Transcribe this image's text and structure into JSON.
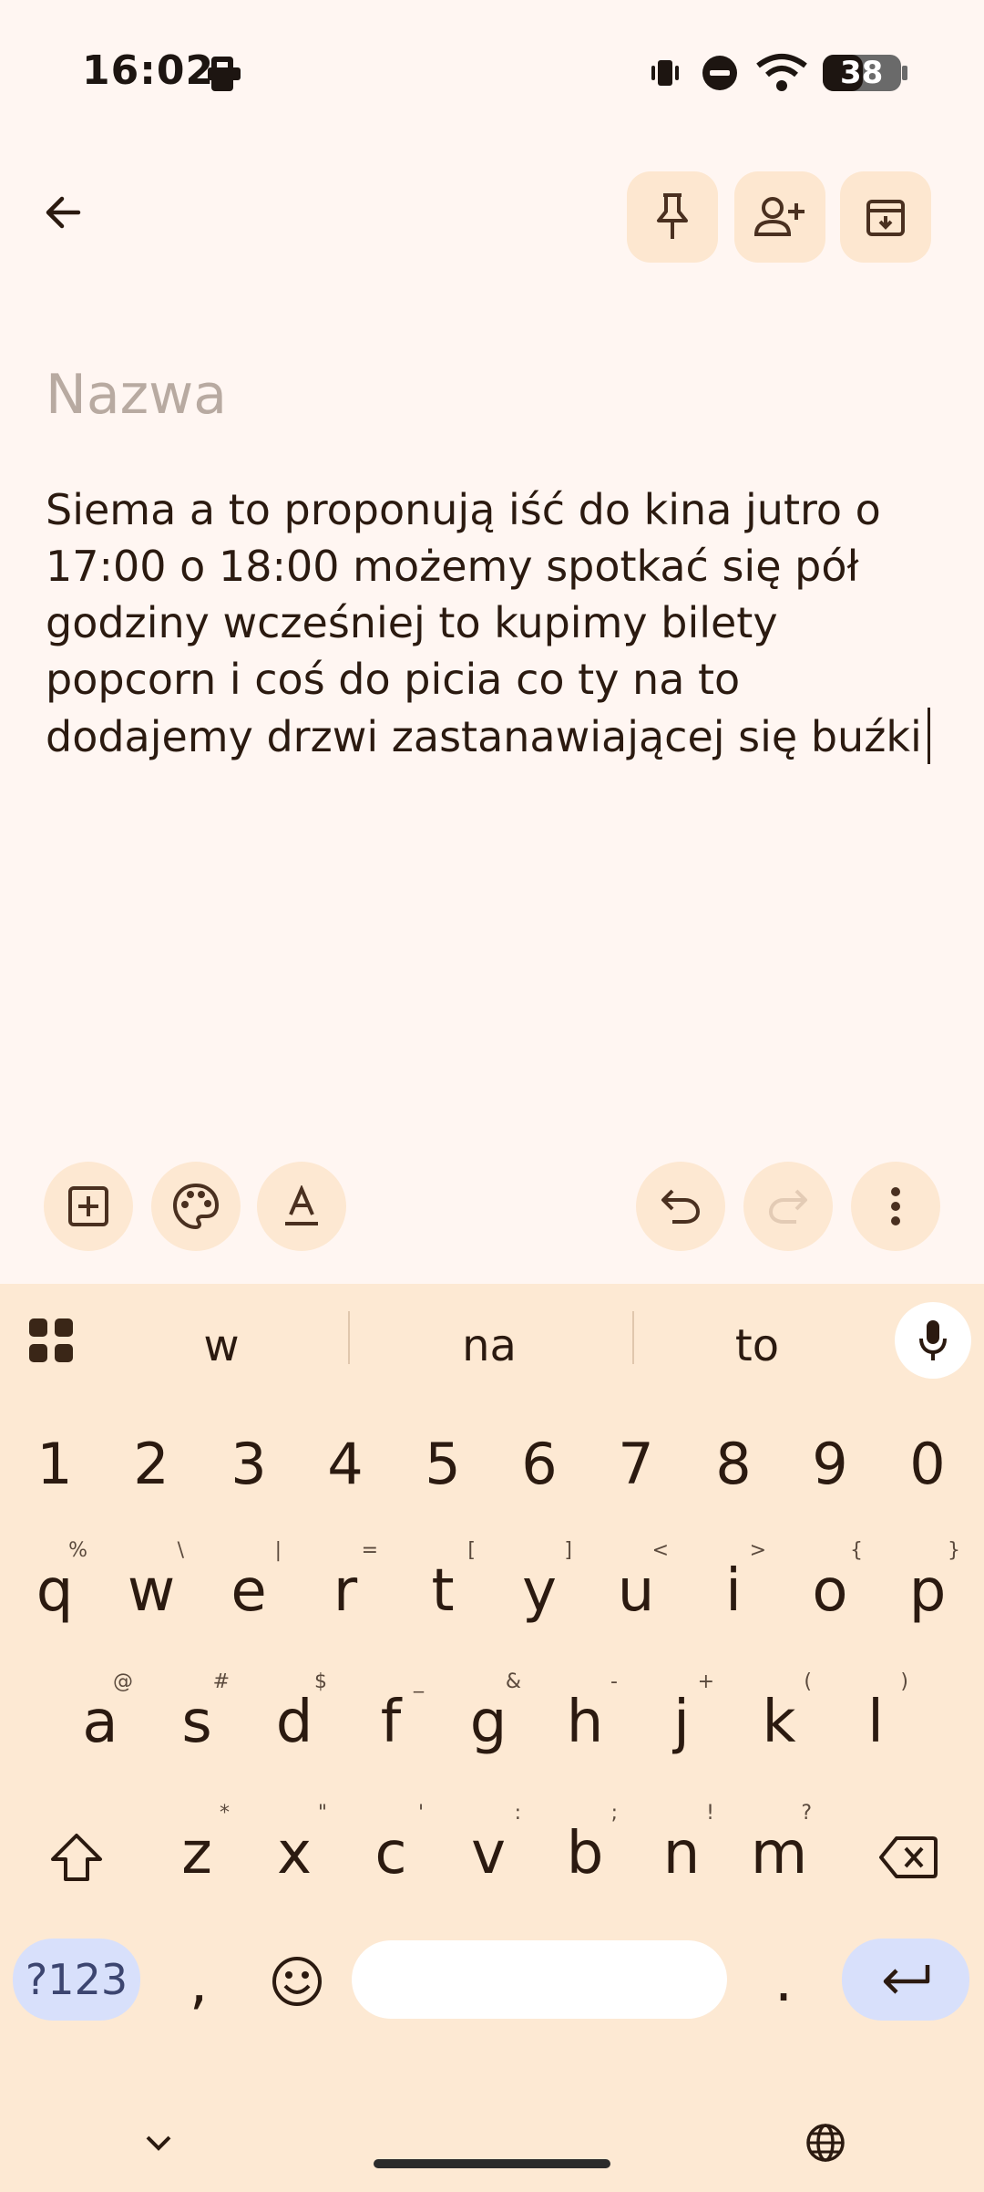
{
  "status_bar": {
    "time": "16:02",
    "battery": "38"
  },
  "note": {
    "title_placeholder": "Nazwa",
    "body": "Siema a to proponują iść do kina jutro o 17:00 o 18:00 możemy spotkać się pół godziny wcześniej to kupimy bilety popcorn i coś do picia co ty na to dodajemy drzwi zastanawiającej się buźki"
  },
  "top_actions": [
    "back-icon",
    "pin-icon",
    "add-collaborator-icon",
    "archive-icon"
  ],
  "note_toolbar": [
    "add-box-icon",
    "palette-icon",
    "text-format-icon",
    "undo-icon",
    "redo-icon",
    "more-vert-icon"
  ],
  "keyboard": {
    "suggestions": [
      "w",
      "na",
      "to"
    ],
    "numbers": [
      "1",
      "2",
      "3",
      "4",
      "5",
      "6",
      "7",
      "8",
      "9",
      "0"
    ],
    "row1": {
      "keys": [
        "q",
        "w",
        "e",
        "r",
        "t",
        "y",
        "u",
        "i",
        "o",
        "p"
      ],
      "hints": [
        "%",
        "\\",
        "|",
        "=",
        "[",
        "]",
        "<",
        ">",
        "{",
        "}"
      ]
    },
    "row2": {
      "keys": [
        "a",
        "s",
        "d",
        "f",
        "g",
        "h",
        "j",
        "k",
        "l"
      ],
      "hints": [
        "@",
        "#",
        "$",
        "_",
        "&",
        "-",
        "+",
        "(",
        ")"
      ]
    },
    "row3": {
      "keys": [
        "z",
        "x",
        "c",
        "v",
        "b",
        "n",
        "m"
      ],
      "hints": [
        "*",
        "\"",
        "'",
        ":",
        ";",
        "!",
        "?"
      ]
    },
    "symbols_label": "?123",
    "comma": ",",
    "period": ".",
    "accent_color": "#d8e0fb",
    "background_color": "#fde9d3"
  }
}
